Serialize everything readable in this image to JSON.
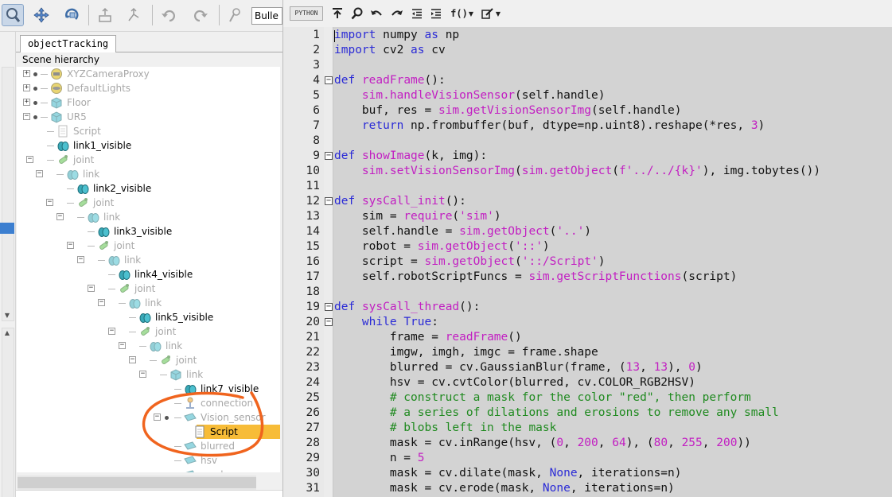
{
  "left_toolbar": {
    "object_combo_value": "Bulle"
  },
  "hierarchy": {
    "tab_label": "objectTracking",
    "header": "Scene hierarchy",
    "rows": [
      {
        "label": "XYZCameraProxy",
        "dim": true,
        "icon": "camera-proxy-icon"
      },
      {
        "label": "DefaultLights",
        "dim": true,
        "icon": "light-icon"
      },
      {
        "label": "Floor",
        "dim": true,
        "icon": "cube-icon"
      },
      {
        "label": "UR5",
        "dim": true,
        "icon": "robot-icon"
      },
      {
        "label": "Script",
        "dim": true,
        "icon": "script-icon"
      },
      {
        "label": "link1_visible",
        "dim": false,
        "icon": "shape-icon"
      },
      {
        "label": "joint",
        "dim": true,
        "icon": "joint-icon"
      },
      {
        "label": "link",
        "dim": true,
        "icon": "shape-icon"
      },
      {
        "label": "link2_visible",
        "dim": false,
        "icon": "shape-icon"
      },
      {
        "label": "joint",
        "dim": true,
        "icon": "joint-icon"
      },
      {
        "label": "link",
        "dim": true,
        "icon": "shape-icon"
      },
      {
        "label": "link3_visible",
        "dim": false,
        "icon": "shape-icon"
      },
      {
        "label": "joint",
        "dim": true,
        "icon": "joint-icon"
      },
      {
        "label": "link",
        "dim": true,
        "icon": "shape-icon"
      },
      {
        "label": "link4_visible",
        "dim": false,
        "icon": "shape-icon"
      },
      {
        "label": "joint",
        "dim": true,
        "icon": "joint-icon"
      },
      {
        "label": "link",
        "dim": true,
        "icon": "shape-icon"
      },
      {
        "label": "link5_visible",
        "dim": false,
        "icon": "shape-icon"
      },
      {
        "label": "joint",
        "dim": true,
        "icon": "joint-icon"
      },
      {
        "label": "link",
        "dim": true,
        "icon": "shape-icon"
      },
      {
        "label": "joint",
        "dim": true,
        "icon": "joint-icon"
      },
      {
        "label": "link",
        "dim": true,
        "icon": "cube-icon"
      },
      {
        "label": "link7_visible",
        "dim": false,
        "icon": "shape-icon"
      },
      {
        "label": "connection",
        "dim": true,
        "icon": "connection-icon"
      },
      {
        "label": "Vision_sensor",
        "dim": true,
        "icon": "vision-sensor-icon"
      },
      {
        "label": "Script",
        "dim": false,
        "icon": "script-icon",
        "selected": true
      },
      {
        "label": "blurred",
        "dim": true,
        "icon": "vision-sensor-icon"
      },
      {
        "label": "hsv",
        "dim": true,
        "icon": "vision-sensor-icon"
      },
      {
        "label": "mask",
        "dim": true,
        "icon": "vision-sensor-icon"
      }
    ]
  },
  "editor": {
    "language_badge": "PYTHON",
    "function_menu": "f()",
    "lines": [
      {
        "n": "1",
        "text": "import numpy as np"
      },
      {
        "n": "2",
        "text": "import cv2 as cv"
      },
      {
        "n": "3",
        "text": ""
      },
      {
        "n": "4",
        "text": "def readFrame():"
      },
      {
        "n": "5",
        "text": "    sim.handleVisionSensor(self.handle)"
      },
      {
        "n": "6",
        "text": "    buf, res = sim.getVisionSensorImg(self.handle)"
      },
      {
        "n": "7",
        "text": "    return np.frombuffer(buf, dtype=np.uint8).reshape(*res, 3)"
      },
      {
        "n": "8",
        "text": ""
      },
      {
        "n": "9",
        "text": "def showImage(k, img):"
      },
      {
        "n": "10",
        "text": "    sim.setVisionSensorImg(sim.getObject(f'../../{k}'), img.tobytes())"
      },
      {
        "n": "11",
        "text": ""
      },
      {
        "n": "12",
        "text": "def sysCall_init():"
      },
      {
        "n": "13",
        "text": "    sim = require('sim')"
      },
      {
        "n": "14",
        "text": "    self.handle = sim.getObject('..')"
      },
      {
        "n": "15",
        "text": "    robot = sim.getObject('::')"
      },
      {
        "n": "16",
        "text": "    script = sim.getObject('::/Script')"
      },
      {
        "n": "17",
        "text": "    self.robotScriptFuncs = sim.getScriptFunctions(script)"
      },
      {
        "n": "18",
        "text": ""
      },
      {
        "n": "19",
        "text": "def sysCall_thread():"
      },
      {
        "n": "20",
        "text": "    while True:"
      },
      {
        "n": "21",
        "text": "        frame = readFrame()"
      },
      {
        "n": "22",
        "text": "        imgw, imgh, imgc = frame.shape"
      },
      {
        "n": "23",
        "text": "        blurred = cv.GaussianBlur(frame, (13, 13), 0)"
      },
      {
        "n": "24",
        "text": "        hsv = cv.cvtColor(blurred, cv.COLOR_RGB2HSV)"
      },
      {
        "n": "25",
        "text": "        # construct a mask for the color \"red\", then perform"
      },
      {
        "n": "26",
        "text": "        # a series of dilations and erosions to remove any small"
      },
      {
        "n": "27",
        "text": "        # blobs left in the mask"
      },
      {
        "n": "28",
        "text": "        mask = cv.inRange(hsv, (0, 200, 64), (80, 255, 200))"
      },
      {
        "n": "29",
        "text": "        n = 5"
      },
      {
        "n": "30",
        "text": "        mask = cv.dilate(mask, None, iterations=n)"
      },
      {
        "n": "31",
        "text": "        mask = cv.erode(mask, None, iterations=n)"
      }
    ]
  },
  "colors": {
    "keyword": "#2b2bd6",
    "function": "#c21fc2",
    "comment": "#1f8a1f",
    "selection": "#f7bc38",
    "annotation": "#f0641e"
  }
}
